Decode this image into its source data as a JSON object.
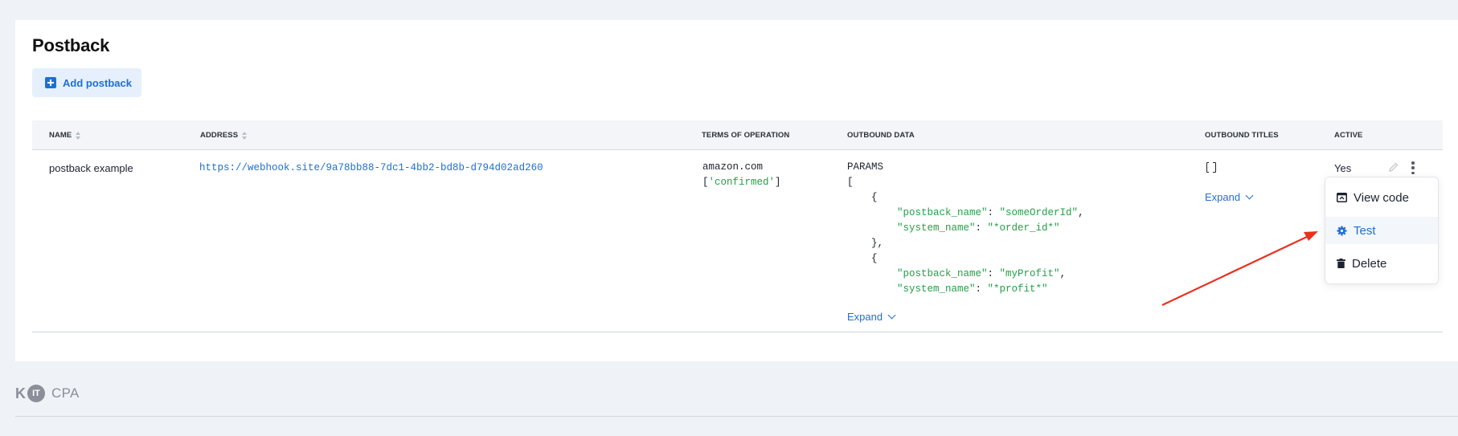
{
  "page": {
    "title": "Postback"
  },
  "toolbar": {
    "add_label": "Add postback"
  },
  "table": {
    "columns": {
      "name": "NAME",
      "address": "ADDRESS",
      "terms": "TERMS OF OPERATION",
      "outbound_data": "OUTBOUND DATA",
      "outbound_titles": "OUTBOUND TITLES",
      "active": "ACTIVE"
    },
    "rows": [
      {
        "name": "postback example",
        "address": "https://webhook.site/9a78bb88-7dc1-4bb2-bd8b-d794d02ad260",
        "terms_domain": "amazon.com",
        "terms_status_open": "[",
        "terms_status": "'confirmed'",
        "terms_status_close": "]",
        "outbound": {
          "label": "PARAMS",
          "open_bracket": "[",
          "brace_open_1": "{",
          "item1_key1": "\"postback_name\"",
          "item1_val1": "\"someOrderId\"",
          "item1_key2": "\"system_name\"",
          "item1_val2": "\"*order_id*\"",
          "brace_close_1": "},",
          "brace_open_2": "{",
          "item2_key1": "\"postback_name\"",
          "item2_val1": "\"myProfit\"",
          "item2_key2": "\"system_name\"",
          "item2_val2": "\"*profit*\"",
          "expand_label": "Expand"
        },
        "titles_expand_label": "Expand",
        "active": "Yes"
      }
    ]
  },
  "context_menu": {
    "items": [
      {
        "label": "View code",
        "icon": "view-code-icon"
      },
      {
        "label": "Test",
        "icon": "gear-icon"
      },
      {
        "label": "Delete",
        "icon": "trash-icon"
      }
    ]
  },
  "footer": {
    "logo_k": "K",
    "logo_it": "IT",
    "logo_cpa": "CPA"
  },
  "colors": {
    "accent": "#1f6fd1",
    "code_string": "#22a048",
    "annotation_arrow": "#e8321e"
  }
}
